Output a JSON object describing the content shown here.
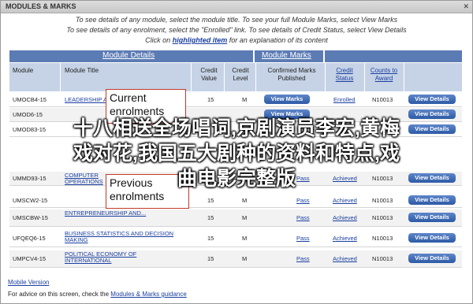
{
  "window": {
    "title": "MODULES & MARKS",
    "controls": "✕"
  },
  "instructions": {
    "line1": "To see details of any module, select the module title. To see your full Module Marks, select View Marks",
    "line2": "To see details of any enrolment, select the \"Enrolled\" link. To see details of Credit Status, select View Details",
    "line3_prefix": "Click on",
    "line3_link": "highlighted item",
    "line3_suffix": "for an explanation of its content"
  },
  "banner": {
    "module_details": "Module Details",
    "module_marks": "Module Marks",
    "credit_status": "Credit Status"
  },
  "headers": {
    "module": "Module",
    "module_title": "Module Title",
    "credit_value": "Credit Value",
    "credit_level": "Credit Level",
    "confirmed": "Confirmed Marks Published",
    "credit_status": "Credit Status",
    "counts_to": "Counts to Award"
  },
  "rows": [
    {
      "code": "UMOCB4-15",
      "title": "LEADERSHIP AND...",
      "credit": "15",
      "level": "M",
      "marks_btn": "View Marks",
      "status": "Enrolled",
      "counts": "N10013",
      "details_btn": "View Details"
    },
    {
      "code": "UMOD6-15",
      "title": "",
      "credit": "",
      "level": "",
      "marks_btn": "View Marks",
      "status": "",
      "counts": "",
      "details_btn": "View Details"
    },
    {
      "code": "UMOD83-15",
      "title": "",
      "credit": "",
      "level": "",
      "marks_btn": "",
      "status": "",
      "counts": "",
      "details_btn": "View Details"
    },
    {
      "code": "UMMD93-15",
      "title": "COMPUTER OPERATIONS",
      "credit": "15",
      "level": "M",
      "marks_btn": "Pass",
      "status": "Achieved",
      "counts": "N10013",
      "details_btn": "View Details"
    },
    {
      "code": "UMSCW2-15",
      "title": "",
      "credit": "15",
      "level": "M",
      "marks_btn": "Pass",
      "status": "Achieved",
      "counts": "N10013",
      "details_btn": "View Details"
    },
    {
      "code": "UMSCBW-15",
      "title": "ENTREPRENEURSHIP AND...",
      "credit": "15",
      "level": "M",
      "marks_btn": "Pass",
      "status": "Achieved",
      "counts": "N10013",
      "details_btn": "View Details"
    },
    {
      "code": "UFQEQ6-15",
      "title": "BUSINESS STATISTICS AND DECISION MAKING",
      "credit": "15",
      "level": "M",
      "marks_btn": "Pass",
      "status": "Achieved",
      "counts": "N10013",
      "details_btn": "View Details"
    },
    {
      "code": "UMPCV4-15",
      "title": "POLITICAL ECONOMY OF INTERNATIONAL",
      "credit": "15",
      "level": "M",
      "marks_btn": "Pass",
      "status": "Achieved",
      "counts": "N10013",
      "details_btn": "View Details"
    }
  ],
  "callouts": {
    "current": "Current enrolments",
    "previous": "Previous enrolments"
  },
  "overlay": {
    "line1": "十八相送全场唱词,京剧演员李宏,黄梅",
    "line2": "戏对花,我国五大剧种的资料和特点,戏",
    "line3": "曲电影完整版"
  },
  "footer": {
    "mobile": "Mobile Version",
    "advice_prefix": "For advice on this screen, check the",
    "advice_link": "Modules & Marks guidance"
  }
}
